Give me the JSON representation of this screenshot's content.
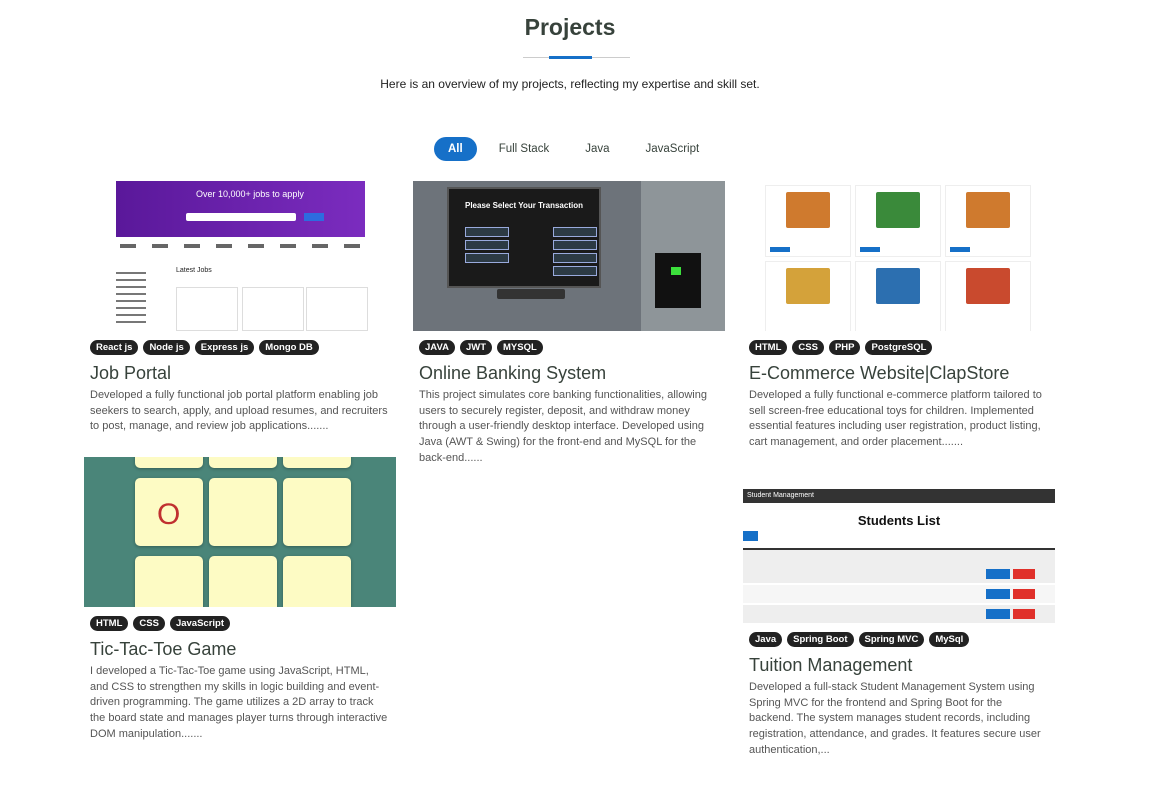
{
  "header": {
    "title": "Projects",
    "subtitle": "Here is an overview of my projects, reflecting my expertise and skill set."
  },
  "filters": [
    "All",
    "Full Stack",
    "Java",
    "JavaScript"
  ],
  "projects": [
    {
      "title": "Job Portal",
      "tags": [
        "React js",
        "Node js",
        "Express js",
        "Mongo DB"
      ],
      "description": "Developed a fully functional job portal platform enabling job seekers to search, apply, and upload resumes, and recruiters to post, manage, and review job applications.......",
      "thumb_text": "Over 10,000+ jobs to apply",
      "thumb_text_2": "Latest Jobs"
    },
    {
      "title": "Online Banking System",
      "tags": [
        "JAVA",
        "JWT",
        "MYSQL"
      ],
      "description": "This project simulates core banking functionalities, allowing users to securely register, deposit, and withdraw money through a user-friendly desktop interface. Developed using Java (AWT & Swing) for the front-end and MySQL for the back-end......",
      "thumb_text": "Please Select Your Transaction"
    },
    {
      "title": "E-Commerce Website|ClapStore",
      "tags": [
        "HTML",
        "CSS",
        "PHP",
        "PostgreSQL"
      ],
      "description": "Developed a fully functional e-commerce platform tailored to sell screen-free educational toys for children. Implemented essential features including user registration, product listing, cart management, and order placement......."
    },
    {
      "title": "Tic-Tac-Toe Game",
      "tags": [
        "HTML",
        "CSS",
        "JavaScript"
      ],
      "description": "I developed a Tic-Tac-Toe game using JavaScript, HTML, and CSS to strengthen my skills in logic building and event-driven programming. The game utilizes a 2D array to track the board state and manages player turns through interactive DOM manipulation.......",
      "thumb_text": "O"
    },
    {
      "title": "Tuition Management",
      "tags": [
        "Java",
        "Spring Boot",
        "Spring MVC",
        "MySql"
      ],
      "description": "Developed a full-stack Student Management System using Spring MVC for the frontend and Spring Boot for the backend. The system manages student records, including registration, attendance, and grades. It features secure user authentication,...",
      "thumb_text": "Students List",
      "thumb_text_2": "Student Management"
    }
  ]
}
